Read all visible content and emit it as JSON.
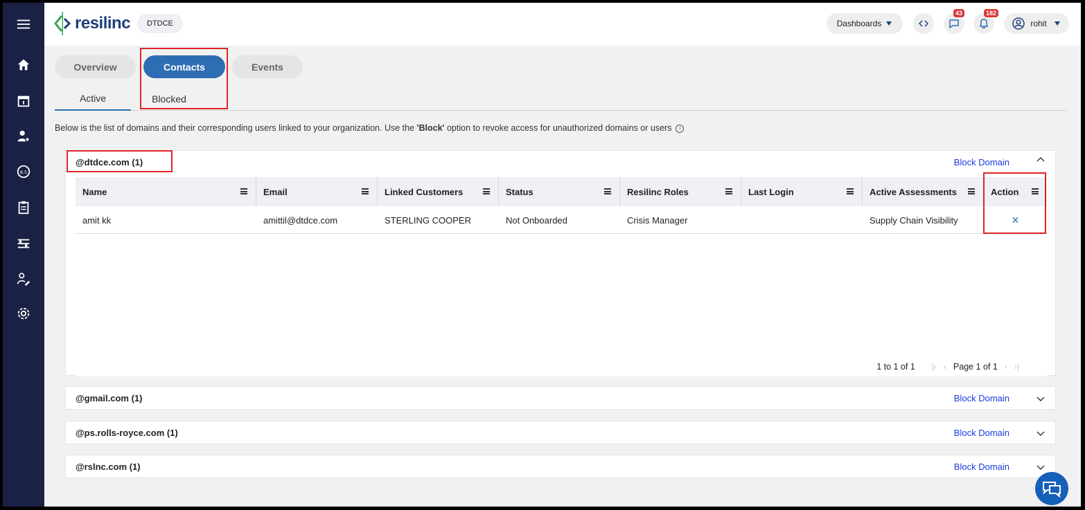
{
  "header": {
    "logo_text": "resilinc",
    "org": "DTDCE",
    "dashboards_label": "Dashboards",
    "messages_count": "43",
    "notifications_count": "182",
    "user_name": "rohit"
  },
  "tabs": [
    {
      "label": "Overview"
    },
    {
      "label": "Contacts"
    },
    {
      "label": "Events"
    }
  ],
  "sub_tabs": [
    {
      "label": "Active"
    },
    {
      "label": "Blocked"
    }
  ],
  "description": {
    "prefix": "Below is the list of domains and their corresponding users linked to your organization. Use the ",
    "bold": "'Block'",
    "suffix": " option to revoke access for unauthorized domains or users"
  },
  "domains": [
    {
      "name": "@dtdce.com (1)",
      "action": "Block Domain"
    },
    {
      "name": "@gmail.com (1)",
      "action": "Block Domain"
    },
    {
      "name": "@ps.rolls-royce.com (1)",
      "action": "Block Domain"
    },
    {
      "name": "@rslnc.com (1)",
      "action": "Block Domain"
    }
  ],
  "grid": {
    "columns": [
      "Name",
      "Email",
      "Linked Customers",
      "Status",
      "Resilinc Roles",
      "Last Login",
      "Active Assessments",
      "Action"
    ],
    "rows": [
      {
        "name": "amit kk",
        "email": "amittil@dtdce.com",
        "linked_customers": "STERLING COOPER",
        "status": "Not Onboarded",
        "roles": "Crisis Manager",
        "last_login": "",
        "active_assessments": "Supply Chain Visibility",
        "action_icon": "×"
      }
    ],
    "pager": {
      "range": "1 to 1 of 1",
      "page": "Page 1 of 1"
    }
  },
  "colors": {
    "sidebar": "#1a2145",
    "accent": "#2e6db3",
    "link": "#1a3be0",
    "highlight": "#e02424"
  }
}
